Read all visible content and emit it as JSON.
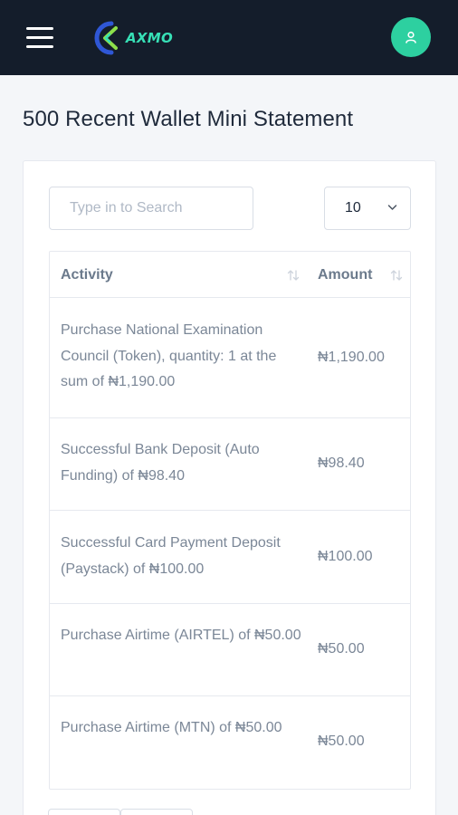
{
  "header": {
    "brand": "AXMO",
    "menu_icon": "hamburger-menu-icon",
    "avatar_icon": "user-icon",
    "avatar_color": "#2dd0a0",
    "background": "#141d2b"
  },
  "page": {
    "title": "500 Recent Wallet Mini Statement"
  },
  "controls": {
    "search_placeholder": "Type in to Search",
    "page_size": "10"
  },
  "table": {
    "columns": [
      "Activity",
      "Amount"
    ],
    "rows": [
      {
        "activity": "Purchase National Examination Council (Token), quantity: 1 at the sum of ₦1,190.00",
        "amount": "₦1,190.00"
      },
      {
        "activity": "Successful Bank Deposit (Auto Funding) of ₦98.40",
        "amount": "₦98.40"
      },
      {
        "activity": "Successful Card Payment Deposit (Paystack) of ₦100.00",
        "amount": "₦100.00"
      },
      {
        "activity": "Purchase Airtime (AIRTEL) of ₦50.00",
        "amount": "₦50.00"
      },
      {
        "activity": "Purchase Airtime (MTN) of ₦50.00",
        "amount": "₦50.00"
      }
    ]
  }
}
